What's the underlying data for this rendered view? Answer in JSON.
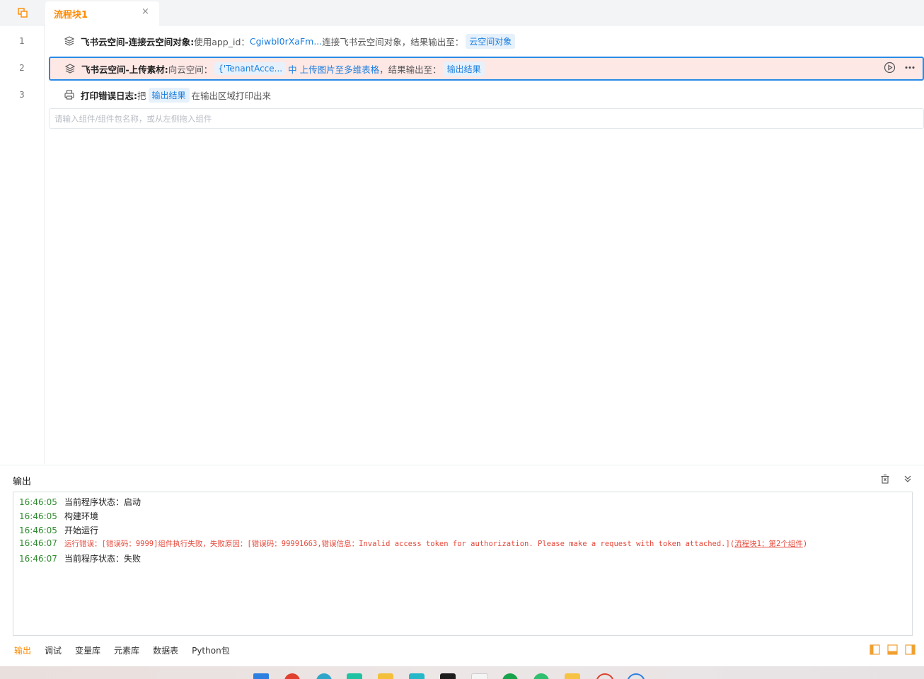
{
  "tabs": [
    {
      "label": "流程块1",
      "close": "×"
    }
  ],
  "editor": {
    "lines": [
      {
        "num": "1",
        "name": "飞书云空间-连接云空间对象:",
        "text1": "使用app_id：",
        "link1": "Cgiwbl0rXaFm...",
        "text2": "连接飞书云空间对象，结果输出至：",
        "chip": "云空间对象"
      },
      {
        "num": "2",
        "name": "飞书云空间-上传素材:",
        "text1": "向云空间：",
        "chip1": "{'TenantAcce...",
        "link1": "中 上传图片至多维表格",
        "text2": "，结果输出至：",
        "chip2": "输出结果"
      },
      {
        "num": "3",
        "name": "打印错误日志:",
        "text1": "把",
        "chip": "输出结果",
        "text2": "在输出区域打印出来"
      }
    ],
    "input_placeholder": "请输入组件/组件包名称，或从左侧拖入组件"
  },
  "output": {
    "title": "输出",
    "logs": [
      {
        "time": "16:46:05",
        "msg": "当前程序状态：启动",
        "error": false
      },
      {
        "time": "16:46:05",
        "msg": "构建环境",
        "error": false
      },
      {
        "time": "16:46:05",
        "msg": "开始运行",
        "error": false
      },
      {
        "time": "16:46:07",
        "msg": "运行错误：[错误码：9999]组件执行失败，失败原因：[错误码：99991663,错误信息：Invalid access token for authorization. Please make a request with token attached.](",
        "link": "流程块1：第2个组件",
        "tail": ")",
        "error": true
      },
      {
        "time": "16:46:07",
        "msg": "当前程序状态：失败",
        "error": false
      }
    ]
  },
  "bottom_tabs": [
    "输出",
    "调试",
    "变量库",
    "元素库",
    "数据表",
    "Python包"
  ],
  "colors": {
    "accent": "#ff8a00",
    "link": "#1a7ee0",
    "error": "#e5483a",
    "time": "#2e8b2e",
    "selected_bg": "#fde8e6",
    "selected_border": "#2b8ae6"
  }
}
